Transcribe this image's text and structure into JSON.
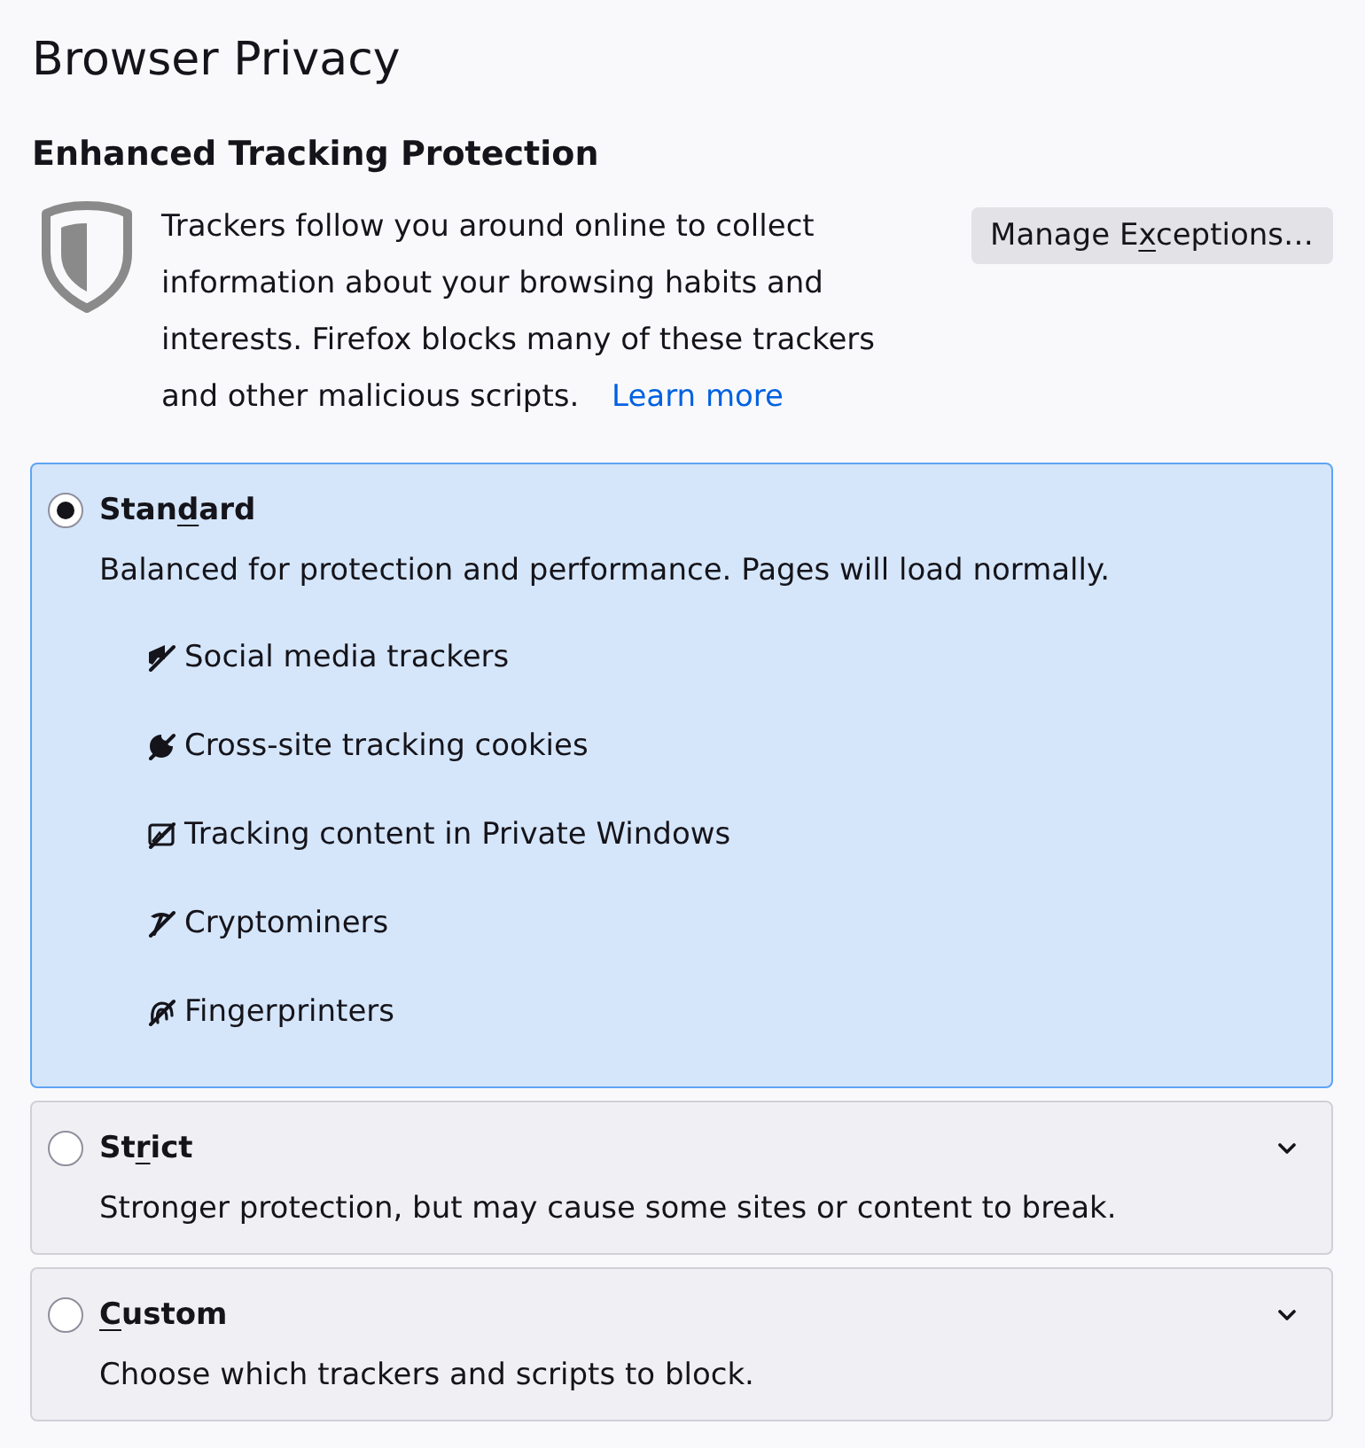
{
  "page": {
    "title": "Browser Privacy"
  },
  "section": {
    "heading": "Enhanced Tracking Protection",
    "description": "Trackers follow you around online to collect information about your browsing habits and interests. Firefox blocks many of these trackers and other malicious scripts.",
    "learn_more_link": "Learn more",
    "exceptions_button": {
      "before": "Manage E",
      "access_key": "x",
      "after": "ceptions…"
    }
  },
  "protection_levels": [
    {
      "label": {
        "before": "Stan",
        "access_key": "d",
        "after": "ard"
      },
      "selected": true,
      "expanded": true,
      "description": "Balanced for protection and performance. Pages will load normally.",
      "features": [
        {
          "kind": "social",
          "label": "Social media trackers"
        },
        {
          "kind": "cookies",
          "label": "Cross-site tracking cookies"
        },
        {
          "kind": "content",
          "label": "Tracking content in Private Windows"
        },
        {
          "kind": "cryptominers",
          "label": "Cryptominers"
        },
        {
          "kind": "fingerprinters",
          "label": "Fingerprinters"
        }
      ]
    },
    {
      "label": {
        "before": "St",
        "access_key": "r",
        "after": "ict"
      },
      "selected": false,
      "expanded": false,
      "description": "Stronger protection, but may cause some sites or content to break."
    },
    {
      "label": {
        "access_key": "C",
        "after": "ustom"
      },
      "selected": false,
      "expanded": false,
      "description": "Choose which trackers and scripts to block."
    }
  ]
}
